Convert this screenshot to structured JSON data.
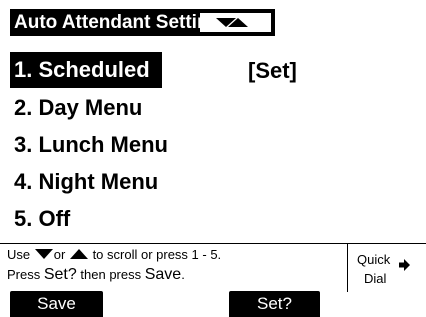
{
  "title": "Auto Attendant Settings",
  "scroll_indicator_icons": [
    "triangle-down-icon",
    "triangle-up-icon"
  ],
  "menu": {
    "items": [
      {
        "label": "1. Scheduled",
        "status": "[Set]",
        "selected": true
      },
      {
        "label": "2. Day Menu"
      },
      {
        "label": "3. Lunch Menu"
      },
      {
        "label": "4. Night Menu"
      },
      {
        "label": "5. Off"
      }
    ]
  },
  "hint": {
    "line1_a": "Use",
    "line1_b": "or",
    "line1_c": "to scroll or press 1 - 5.",
    "line2_a": "Press",
    "line2_set": "Set?",
    "line2_b": "then press",
    "line2_save": "Save",
    "line2_c": "."
  },
  "quick_dial": {
    "line1": "Quick",
    "line2": "Dial",
    "icon": "arrow-right-icon"
  },
  "softkeys": {
    "save": "Save",
    "set": "Set?"
  },
  "colors": {
    "foreground": "#000000",
    "background": "#ffffff"
  }
}
